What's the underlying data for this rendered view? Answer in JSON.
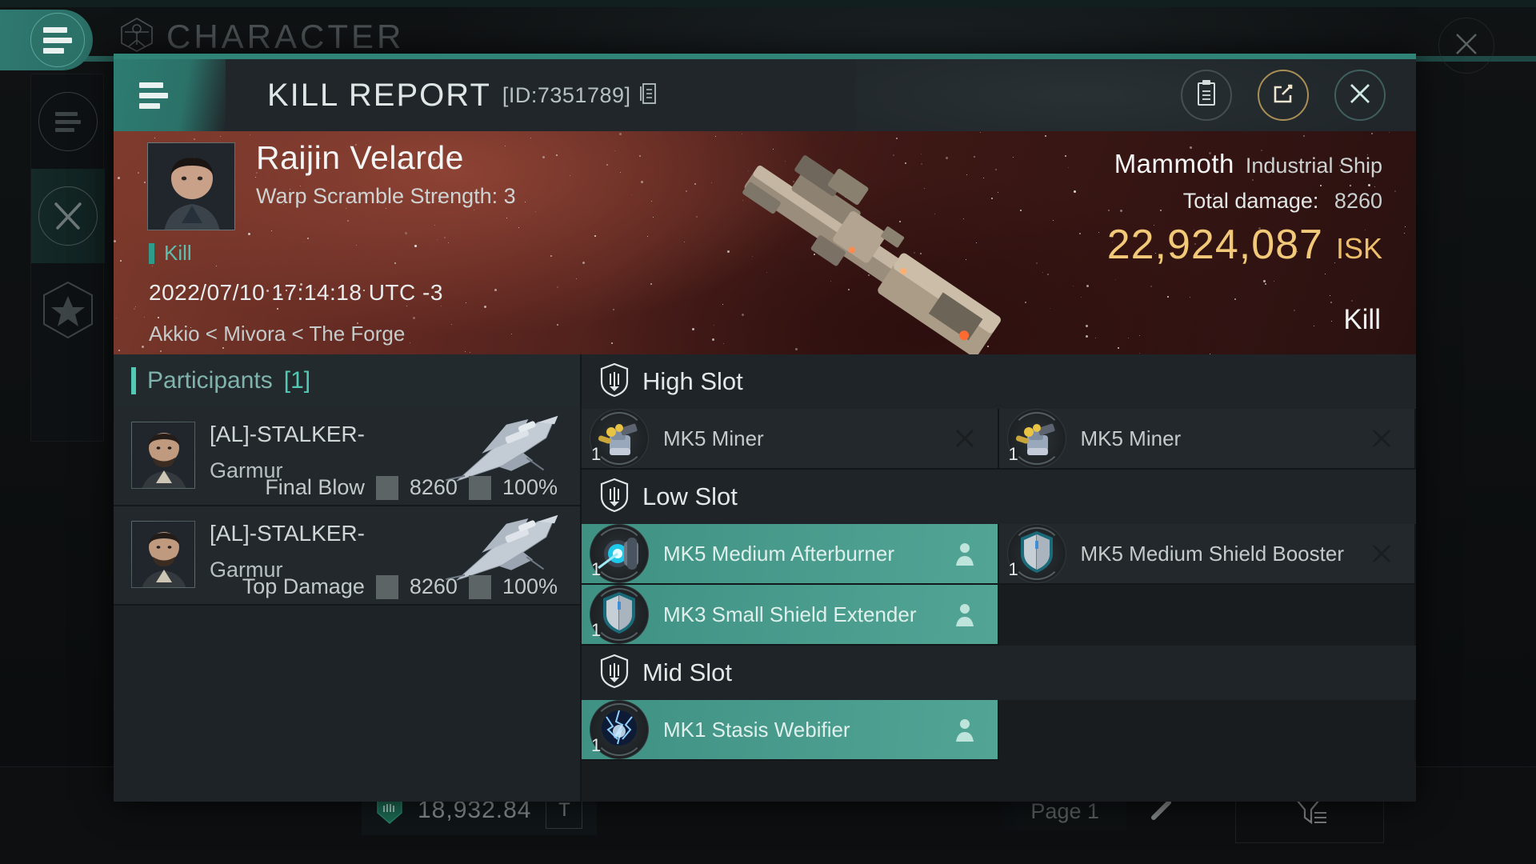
{
  "background": {
    "title": "CHARACTER",
    "title_icon": "vitruvian-character-icon",
    "sidebar": [
      {
        "icon": "menu-list-icon",
        "label": "Menu"
      },
      {
        "icon": "crossed-swords-icon",
        "label": "Combat"
      },
      {
        "icon": "star-badge-icon",
        "label": "Achievements"
      }
    ],
    "hamburger_icon": "hamburger-menu-icon",
    "close_icon": "close-x-icon",
    "wallet": {
      "icon": "wallet-icon",
      "amount": "18,932.84",
      "button_label": "T"
    },
    "pagination": {
      "page_label": "Page 1",
      "edit_icon": "pencil-edit-icon"
    },
    "filter_icon": "filter-funnel-icon"
  },
  "modal": {
    "menu_icon": "hamburger-menu-icon",
    "title": "KILL REPORT",
    "id_label": "[ID:7351789]",
    "copy_icon": "copy-icon",
    "actions": [
      {
        "name": "clipboard-button",
        "icon": "clipboard-icon"
      },
      {
        "name": "share-button",
        "icon": "external-link-icon"
      },
      {
        "name": "close-button",
        "icon": "close-x-icon"
      }
    ]
  },
  "banner": {
    "victim_name": "Raijin Velarde",
    "victim_subtitle": "Warp Scramble Strength: 3",
    "kill_tag": "Kill",
    "timestamp": "2022/07/10 17:14:18 UTC -3",
    "location": "Akkio < Mivora < The Forge",
    "ship_name": "Mammoth",
    "ship_class": "Industrial Ship",
    "total_damage_label": "Total damage:",
    "total_damage_value": "8260",
    "isk_value": "22,924,087",
    "isk_unit": "ISK",
    "result": "Kill",
    "portrait_icon": "victim-portrait",
    "ship_icon": "mammoth-ship-render"
  },
  "participants": {
    "header_label": "Participants",
    "count_label": "[1]",
    "rows": [
      {
        "name": "[AL]-STALKER-",
        "ship": "Garmur",
        "role": "Final Blow",
        "damage": "8260",
        "percent": "100%"
      },
      {
        "name": "[AL]-STALKER-",
        "ship": "Garmur",
        "role": "Top Damage",
        "damage": "8260",
        "percent": "100%"
      }
    ]
  },
  "fitting": {
    "sections": [
      {
        "name": "High Slot",
        "icon": "slot-shield-icon",
        "items": [
          {
            "label": "MK5 Miner",
            "qty": "1",
            "icon": "mining-laser-icon",
            "highlight": false,
            "action": "remove-x-icon"
          },
          {
            "label": "MK5 Miner",
            "qty": "1",
            "icon": "mining-laser-icon",
            "highlight": false,
            "action": "remove-x-icon"
          }
        ]
      },
      {
        "name": "Low Slot",
        "icon": "slot-shield-icon",
        "items": [
          {
            "label": "MK5 Medium Afterburner",
            "qty": "1",
            "icon": "afterburner-icon",
            "highlight": true,
            "action": "person-icon"
          },
          {
            "label": "MK5 Medium Shield Booster",
            "qty": "1",
            "icon": "shield-booster-icon",
            "highlight": false,
            "action": "remove-x-icon"
          },
          {
            "label": "MK3 Small Shield Extender",
            "qty": "1",
            "icon": "shield-extender-icon",
            "highlight": true,
            "action": "person-icon"
          }
        ]
      },
      {
        "name": "Mid Slot",
        "icon": "slot-shield-icon",
        "items": [
          {
            "label": "MK1 Stasis Webifier",
            "qty": "1",
            "icon": "stasis-webifier-icon",
            "highlight": true,
            "action": "person-icon"
          }
        ]
      }
    ]
  },
  "colors": {
    "accent_teal": "#2f8377",
    "highlight_teal": "#4a9c8d",
    "isk_gold": "#f2c978",
    "banner_red": "#5c2620",
    "panel_dark": "#1e2327"
  }
}
